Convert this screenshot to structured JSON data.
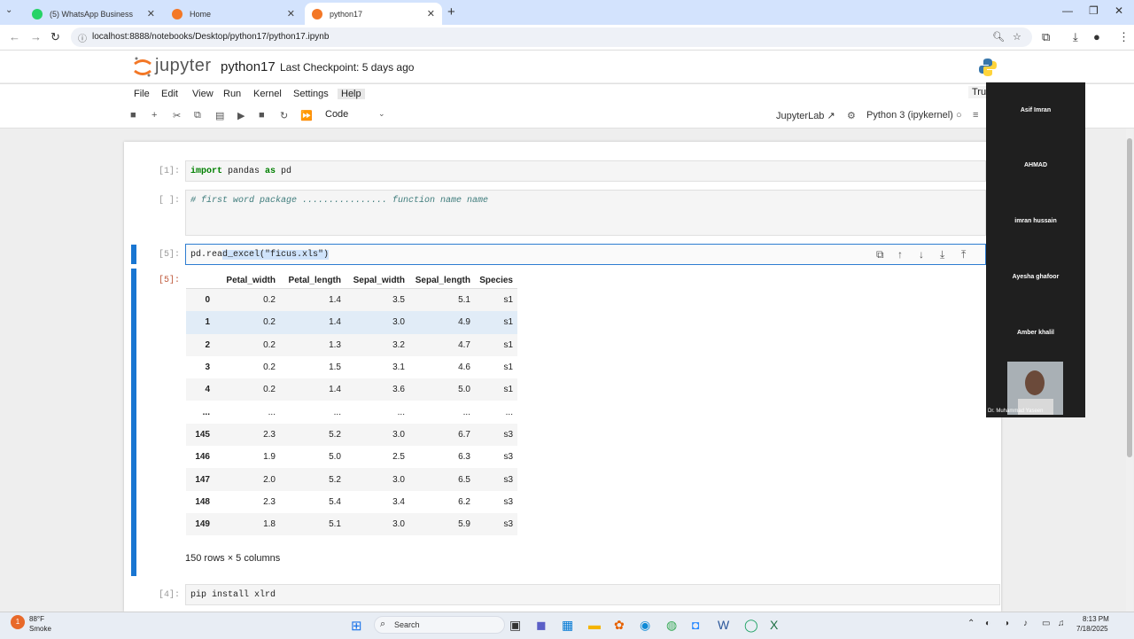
{
  "browser": {
    "tabs": [
      {
        "label": "(5) WhatsApp Business",
        "favicon_color": "#25d366"
      },
      {
        "label": "Home",
        "favicon_color": "#f37726"
      },
      {
        "label": "python17",
        "favicon_color": "#f37726"
      }
    ],
    "url": "localhost:8888/notebooks/Desktop/python17/python17.ipynb"
  },
  "jupyter": {
    "logo_text": "jupyter",
    "notebook_title": "python17",
    "checkpoint": "Last Checkpoint: 5 days ago",
    "trusted": "Trus",
    "menu": [
      "File",
      "Edit",
      "View",
      "Run",
      "Kernel",
      "Settings",
      "Help"
    ],
    "celltype": "Code",
    "jupyterlab_label": "JupyterLab",
    "kernel_label": "Python 3 (ipykernel)"
  },
  "cells": {
    "c1": {
      "prompt": "[1]:"
    },
    "c2": {
      "prompt": "[ ]:",
      "comment": "# first word package ................ function name name"
    },
    "c3": {
      "prompt": "[5]:",
      "pre": "pd.rea",
      "sel": "d_excel(\"ficus.xls\")",
      "out_prompt": "[5]:"
    },
    "c4": {
      "prompt": "[4]:",
      "code": "pip install xlrd"
    }
  },
  "dataframe": {
    "columns": [
      "",
      "Petal_width",
      "Petal_length",
      "Sepal_width",
      "Sepal_length",
      "Species"
    ],
    "rows": [
      [
        "0",
        "0.2",
        "1.4",
        "3.5",
        "5.1",
        "s1"
      ],
      [
        "1",
        "0.2",
        "1.4",
        "3.0",
        "4.9",
        "s1"
      ],
      [
        "2",
        "0.2",
        "1.3",
        "3.2",
        "4.7",
        "s1"
      ],
      [
        "3",
        "0.2",
        "1.5",
        "3.1",
        "4.6",
        "s1"
      ],
      [
        "4",
        "0.2",
        "1.4",
        "3.6",
        "5.0",
        "s1"
      ],
      [
        "...",
        "...",
        "...",
        "...",
        "...",
        "..."
      ],
      [
        "145",
        "2.3",
        "5.2",
        "3.0",
        "6.7",
        "s3"
      ],
      [
        "146",
        "1.9",
        "5.0",
        "2.5",
        "6.3",
        "s3"
      ],
      [
        "147",
        "2.0",
        "5.2",
        "3.0",
        "6.5",
        "s3"
      ],
      [
        "148",
        "2.3",
        "5.4",
        "3.4",
        "6.2",
        "s3"
      ],
      [
        "149",
        "1.8",
        "5.1",
        "3.0",
        "5.9",
        "s3"
      ]
    ],
    "summary": "150 rows × 5 columns"
  },
  "meeting": {
    "participants": [
      "Asif Imran",
      "AHMAD",
      "imran hussain",
      "Ayesha ghafoor",
      "Amber khalil"
    ],
    "video_name": "Dr. Muhammad Yaseen"
  },
  "taskbar": {
    "weather_temp": "88°F",
    "weather_desc": "Smoke",
    "weather_badge": "1",
    "search": "Search",
    "time": "8:13 PM",
    "date": "7/18/2025"
  }
}
